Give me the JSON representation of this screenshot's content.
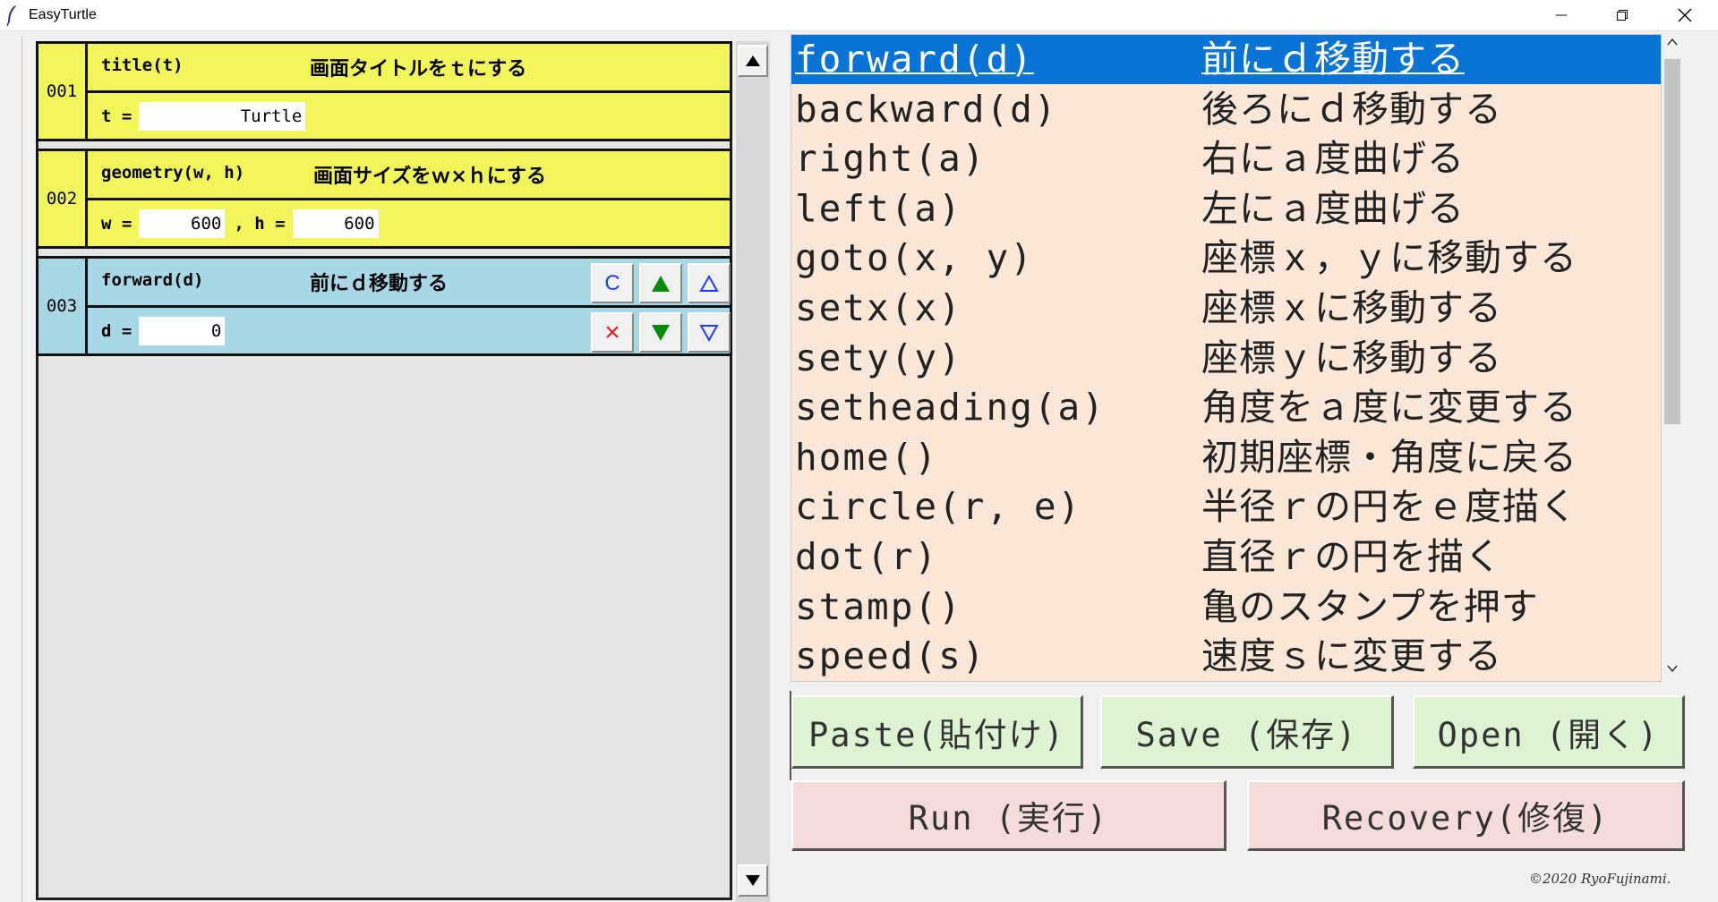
{
  "window": {
    "title": "EasyTurtle",
    "controls": {
      "minimize": "minimize-icon",
      "maximize": "restore-icon",
      "close": "close-icon"
    }
  },
  "blocks": [
    {
      "number": "001",
      "command": "title(t)",
      "description": "画面タイトルをｔにする",
      "color": "#f2f55a",
      "params": [
        {
          "label": "t =",
          "value": "Turtle"
        }
      ]
    },
    {
      "number": "002",
      "command": "geometry(w, h)",
      "description": "画面サイズをｗ×ｈにする",
      "color": "#f2f55a",
      "params": [
        {
          "label": "w =",
          "value": "600"
        },
        {
          "label": ", h =",
          "value": "600"
        }
      ]
    },
    {
      "number": "003",
      "command": "forward(d)",
      "description": "前にｄ移動する",
      "color": "#a8d7e6",
      "params": [
        {
          "label": "d =",
          "value": "0"
        }
      ],
      "controls": {
        "copy": "C",
        "move_up": "filled-up-triangle-icon",
        "insert_above": "outline-up-triangle-icon",
        "delete": "×",
        "move_down": "filled-down-triangle-icon",
        "insert_below": "outline-down-triangle-icon"
      }
    }
  ],
  "command_list": {
    "selected_index": 0,
    "selected_color": "#0a73d6",
    "background_color": "#fae7d7",
    "items": [
      {
        "command": "forward(d)",
        "description": "前にｄ移動する"
      },
      {
        "command": "backward(d)",
        "description": "後ろにｄ移動する"
      },
      {
        "command": "right(a)",
        "description": "右にａ度曲げる"
      },
      {
        "command": "left(a)",
        "description": "左にａ度曲げる"
      },
      {
        "command": "goto(x, y)",
        "description": "座標ｘ，ｙに移動する"
      },
      {
        "command": "setx(x)",
        "description": "座標ｘに移動する"
      },
      {
        "command": "sety(y)",
        "description": "座標ｙに移動する"
      },
      {
        "command": "setheading(a)",
        "description": "角度をａ度に変更する"
      },
      {
        "command": "home()",
        "description": "初期座標・角度に戻る"
      },
      {
        "command": "circle(r, e)",
        "description": "半径ｒの円をｅ度描く"
      },
      {
        "command": "dot(r)",
        "description": "直径ｒの円を描く"
      },
      {
        "command": "stamp()",
        "description": "亀のスタンプを押す"
      },
      {
        "command": "speed(s)",
        "description": "速度ｓに変更する"
      }
    ]
  },
  "actions": {
    "paste": "Paste(貼付け)",
    "save": "Save (保存)",
    "open": "Open (開く)",
    "run": "Run (実行)",
    "recovery": "Recovery(修復)"
  },
  "copyright": "©2020 RyoFujinami."
}
